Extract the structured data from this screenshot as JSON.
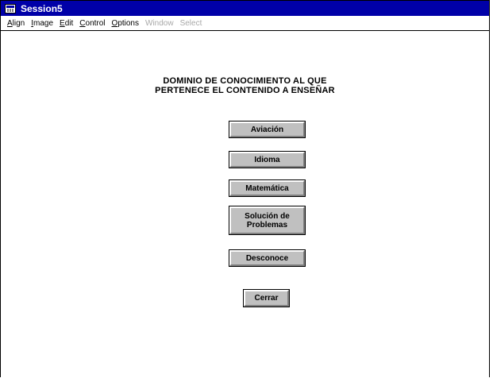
{
  "window": {
    "title": "Session5",
    "icon": "app-window-icon"
  },
  "menu": {
    "items": [
      {
        "mnemonic": "A",
        "rest": "lign",
        "enabled": true
      },
      {
        "mnemonic": "I",
        "rest": "mage",
        "enabled": true
      },
      {
        "mnemonic": "E",
        "rest": "dit",
        "enabled": true
      },
      {
        "mnemonic": "C",
        "rest": "ontrol",
        "enabled": true
      },
      {
        "mnemonic": "O",
        "rest": "ptions",
        "enabled": true
      },
      {
        "mnemonic": "",
        "rest": "Window",
        "enabled": false
      },
      {
        "mnemonic": "",
        "rest": "Select",
        "enabled": false
      }
    ]
  },
  "form": {
    "heading_line1": "DOMINIO DE CONOCIMIENTO AL QUE",
    "heading_line2": "PERTENECE EL CONTENIDO A ENSEÑAR",
    "options": {
      "aviacion": "Aviación",
      "idioma": "Idioma",
      "matematica": "Matemática",
      "solucion_line1": "Solución de",
      "solucion_line2": "Problemas",
      "desconoce": "Desconoce"
    },
    "close_label": "Cerrar"
  },
  "colors": {
    "titlebar": "#0000a8",
    "button_face": "#c0c0c0",
    "disabled_text": "#a8a8a8"
  }
}
